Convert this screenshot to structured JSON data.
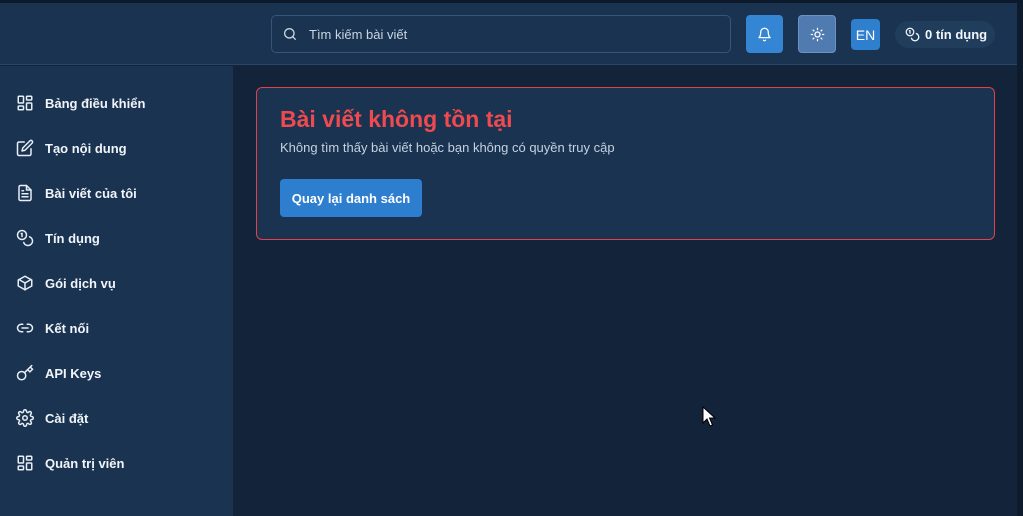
{
  "header": {
    "search": {
      "placeholder": "Tìm kiếm bài viết",
      "icon": "search-icon"
    },
    "notifications_icon": "bell-icon",
    "theme_icon": "sun-icon",
    "language_label": "EN",
    "credits_label": "0 tín dụng",
    "credits_icon": "coins-icon"
  },
  "sidebar": {
    "items": [
      {
        "label": "Bảng điều khiển",
        "icon": "dashboard-icon"
      },
      {
        "label": "Tạo nội dung",
        "icon": "edit-icon"
      },
      {
        "label": "Bài viết của tôi",
        "icon": "document-icon"
      },
      {
        "label": "Tín dụng",
        "icon": "coins-icon"
      },
      {
        "label": "Gói dịch vụ",
        "icon": "package-icon"
      },
      {
        "label": "Kết nối",
        "icon": "link-icon"
      },
      {
        "label": "API Keys",
        "icon": "key-icon"
      },
      {
        "label": "Cài đặt",
        "icon": "gear-icon"
      },
      {
        "label": "Quản trị viên",
        "icon": "admin-grid-icon"
      }
    ]
  },
  "main": {
    "error": {
      "title": "Bài viết không tồn tại",
      "description": "Không tìm thấy bài viết hoặc bạn không có quyền truy cập",
      "back_button": "Quay lại danh sách"
    }
  },
  "colors": {
    "background": "#13233a",
    "panel": "#1a3350",
    "accent": "#2e7ed0",
    "error": "#ee4a4f"
  }
}
